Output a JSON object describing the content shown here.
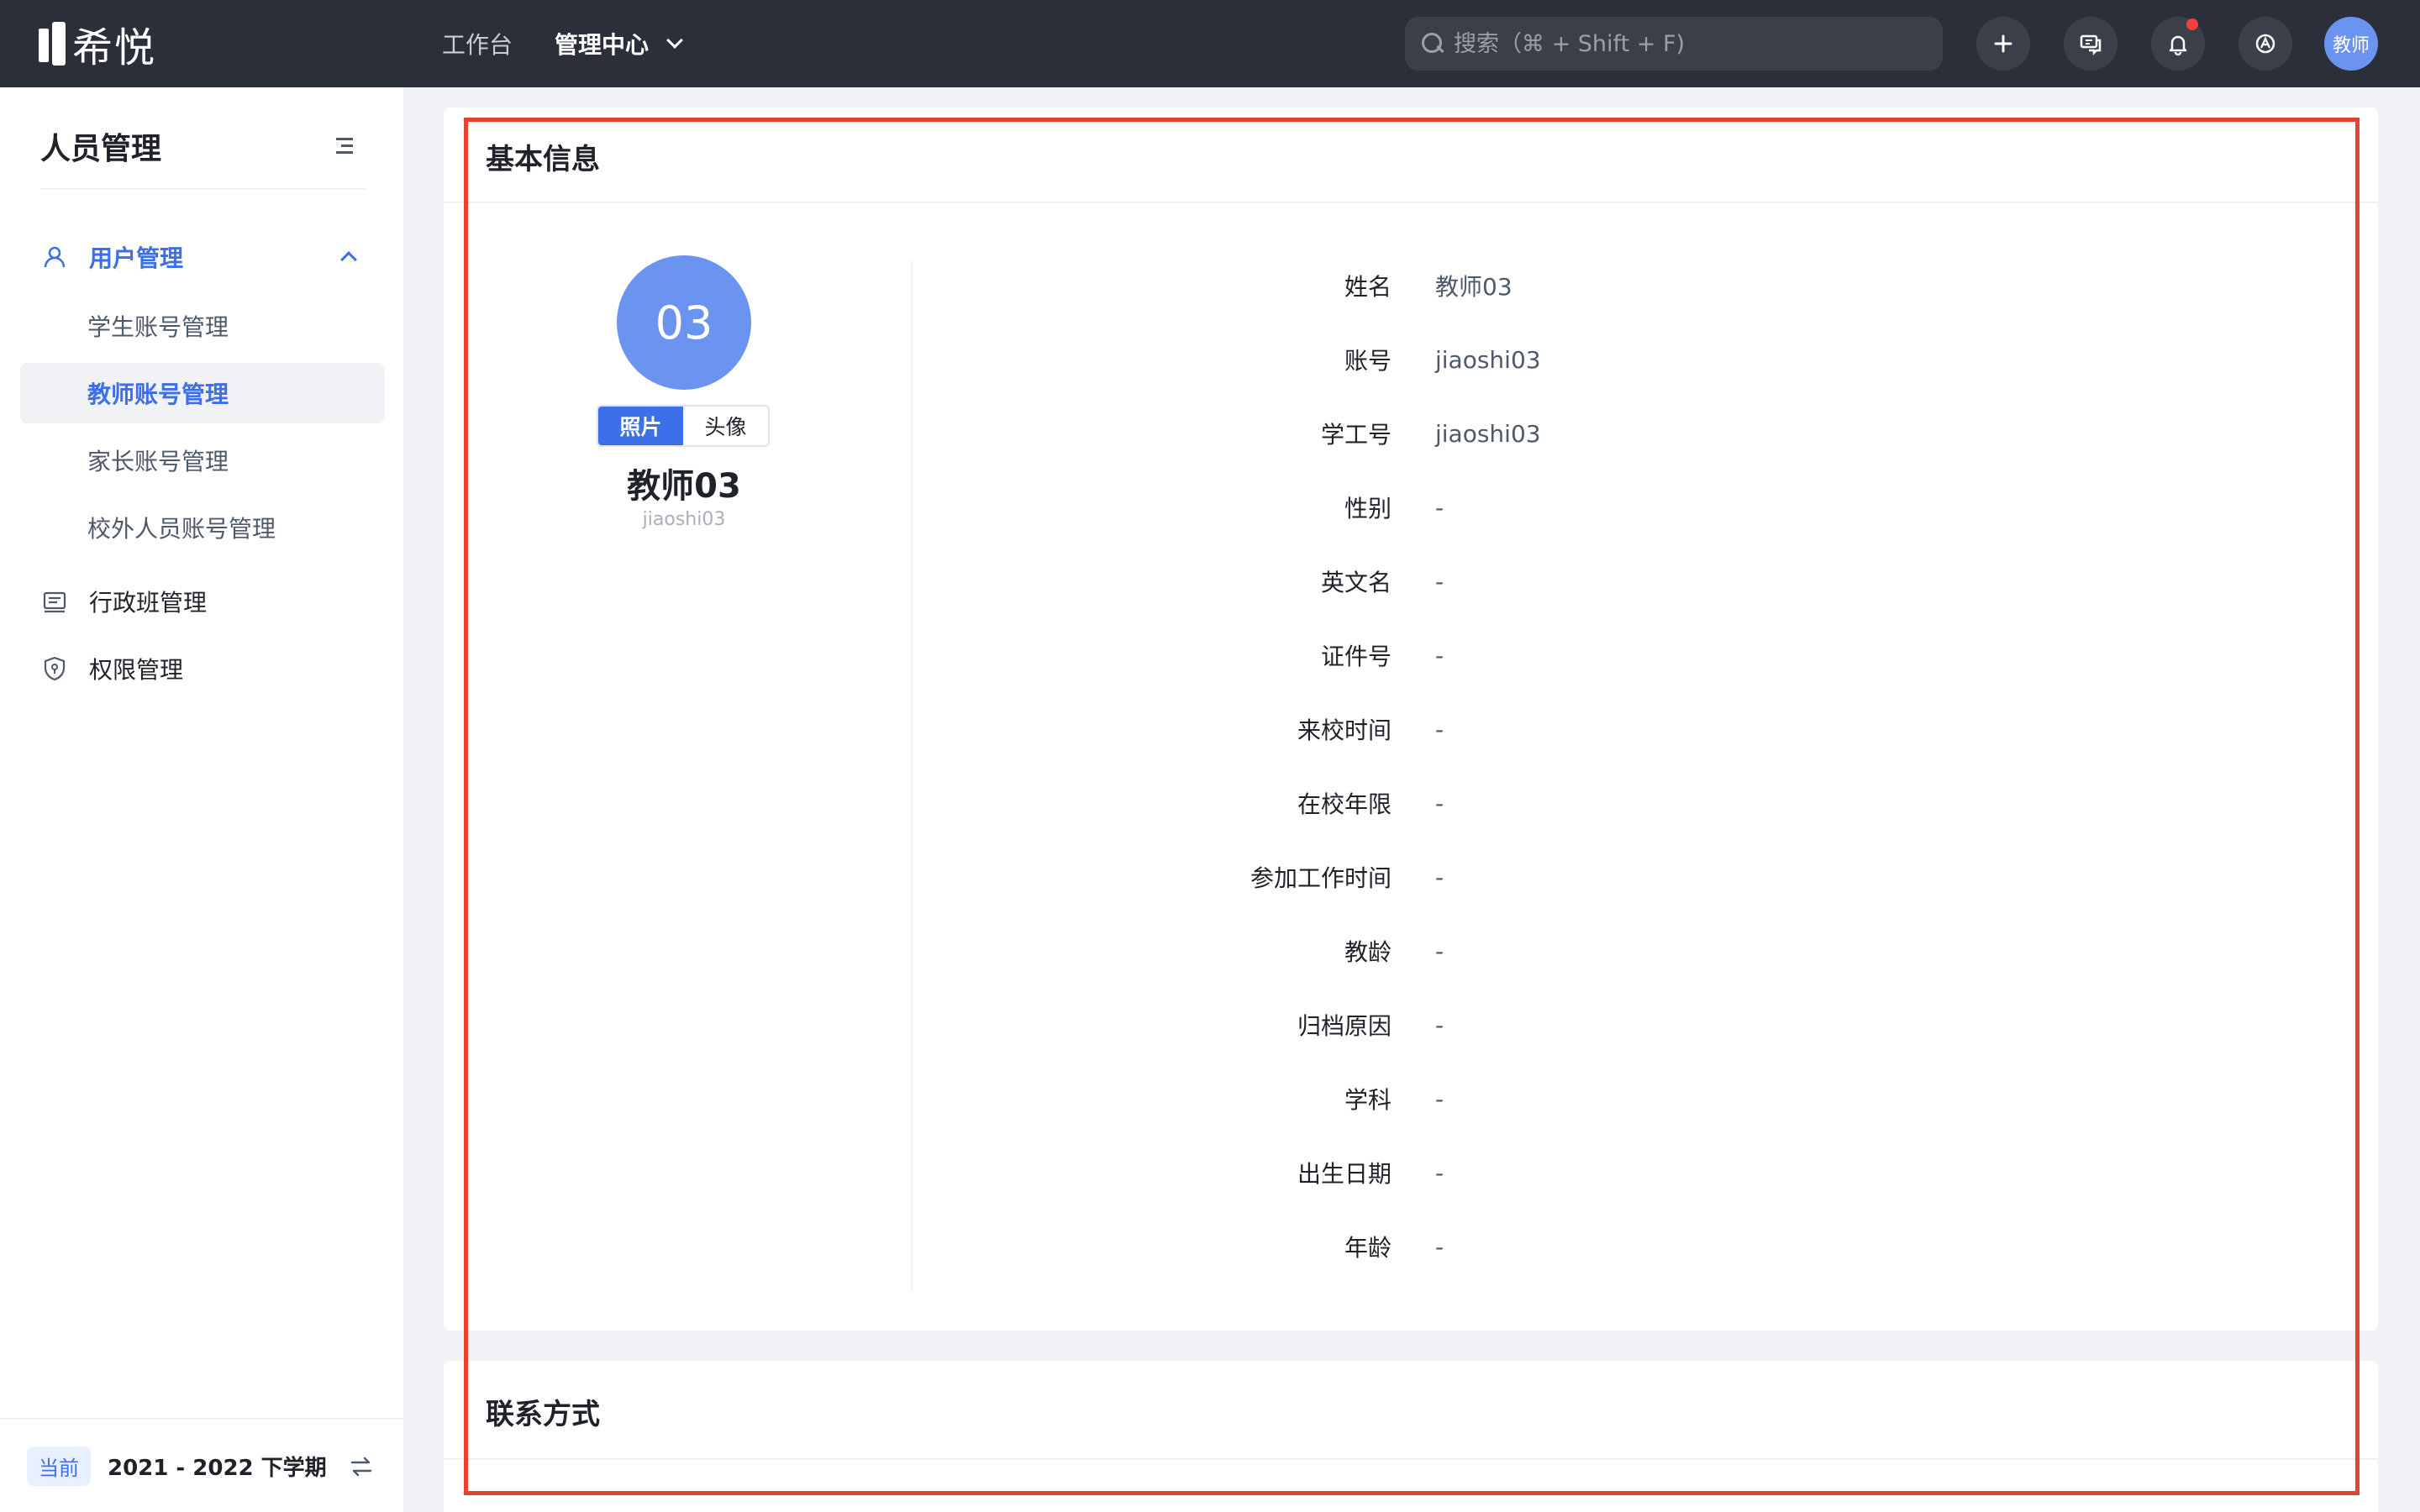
{
  "topbar": {
    "logo_text": "希悦",
    "nav": [
      {
        "label": "工作台"
      },
      {
        "label": "管理中心"
      }
    ],
    "search_placeholder": "搜索（⌘ + Shift + F)",
    "user_avatar_text": "教师"
  },
  "sidebar": {
    "title": "人员管理",
    "group": {
      "label": "用户管理"
    },
    "sub_items": [
      {
        "label": "学生账号管理"
      },
      {
        "label": "教师账号管理"
      },
      {
        "label": "家长账号管理"
      },
      {
        "label": "校外人员账号管理"
      }
    ],
    "items": [
      {
        "label": "行政班管理"
      },
      {
        "label": "权限管理"
      }
    ],
    "term_badge": "当前",
    "term_text": "2021 - 2022 下学期"
  },
  "basic_info": {
    "title": "基本信息",
    "avatar_text": "03",
    "seg": [
      "照片",
      "头像"
    ],
    "name": "教师03",
    "account": "jiaoshi03",
    "fields": [
      {
        "label": "姓名",
        "value": "教师03"
      },
      {
        "label": "账号",
        "value": "jiaoshi03"
      },
      {
        "label": "学工号",
        "value": "jiaoshi03"
      },
      {
        "label": "性别",
        "value": "-"
      },
      {
        "label": "英文名",
        "value": "-"
      },
      {
        "label": "证件号",
        "value": "-"
      },
      {
        "label": "来校时间",
        "value": "-"
      },
      {
        "label": "在校年限",
        "value": "-"
      },
      {
        "label": "参加工作时间",
        "value": "-"
      },
      {
        "label": "教龄",
        "value": "-"
      },
      {
        "label": "归档原因",
        "value": "-"
      },
      {
        "label": "学科",
        "value": "-"
      },
      {
        "label": "出生日期",
        "value": "-"
      },
      {
        "label": "年龄",
        "value": "-"
      }
    ]
  },
  "contact": {
    "title": "联系方式"
  },
  "colors": {
    "accent": "#3c6fe8",
    "avatar": "#6b93f0",
    "highlight_frame": "#e5432f",
    "topbar": "#2b2f3a"
  }
}
